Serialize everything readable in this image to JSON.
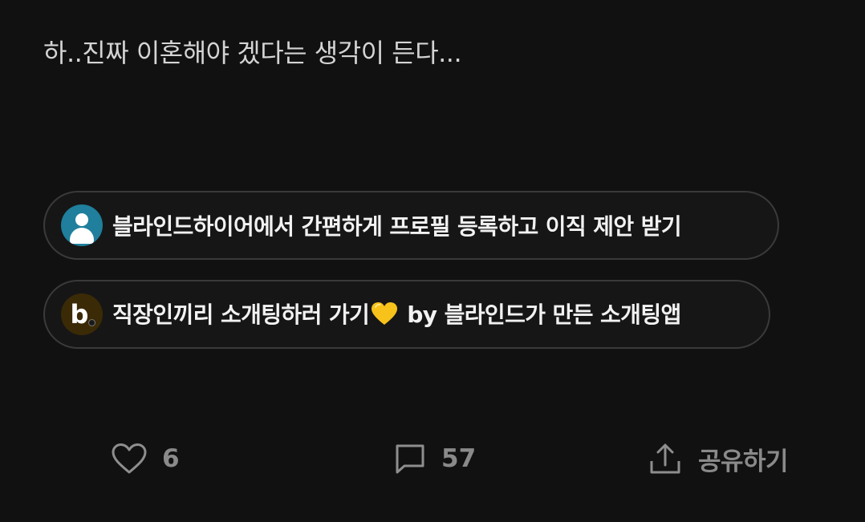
{
  "post": {
    "body": "하..진짜 이혼해야 겠다는 생각이 든다..."
  },
  "promos": [
    {
      "icon": "profile-icon",
      "icon_color": "#1f7f9c",
      "text": "블라인드하이어에서 간편하게 프로필 등록하고 이직 제안 받기"
    },
    {
      "icon": "blind-b-logo-icon",
      "icon_color": "#3b2a06",
      "icon_letter": "b",
      "text_before_emoji": "직장인끼리 소개팅하러 가기",
      "text_after_emoji": " by 블라인드가 만든 소개팅앱",
      "emoji": "yellow-heart-icon"
    }
  ],
  "actions": {
    "like": {
      "icon": "heart-outline-icon",
      "count": "6"
    },
    "comment": {
      "icon": "comment-icon",
      "count": "57"
    },
    "share": {
      "icon": "share-icon",
      "label": "공유하기"
    }
  },
  "colors": {
    "background": "#111111",
    "text_primary": "#d4d4d4",
    "action_gray": "#8e8e8e",
    "emoji_yellow": "#f7c21a"
  }
}
